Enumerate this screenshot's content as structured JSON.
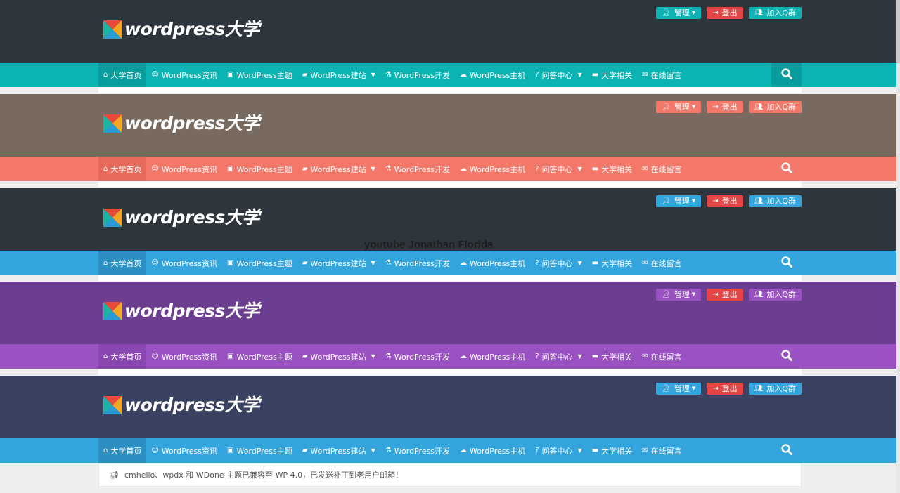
{
  "logo_text": "wordpress大学",
  "top_buttons": {
    "manage": {
      "icon": "user-icon",
      "label": "管理"
    },
    "logout": {
      "icon": "sign-out-icon",
      "label": "登出"
    },
    "join_qq": {
      "icon": "users-icon",
      "label": "加入Q群"
    }
  },
  "nav": [
    {
      "icon": "home-icon",
      "glyph": "⌂",
      "label": "大学首页",
      "dropdown": false
    },
    {
      "icon": "smile-icon",
      "glyph": "☺",
      "label": "WordPress资讯",
      "dropdown": false
    },
    {
      "icon": "picture-icon",
      "glyph": "▣",
      "label": "WordPress主题",
      "dropdown": false
    },
    {
      "icon": "book-icon",
      "glyph": "▰",
      "label": "WordPress建站",
      "dropdown": true
    },
    {
      "icon": "flask-icon",
      "glyph": "⚗",
      "label": "WordPress开发",
      "dropdown": false
    },
    {
      "icon": "cloud-icon",
      "glyph": "☁",
      "label": "WordPress主机",
      "dropdown": false
    },
    {
      "icon": "question-icon",
      "glyph": "?",
      "label": "问答中心",
      "dropdown": true
    },
    {
      "icon": "laptop-icon",
      "glyph": "▬",
      "label": "大学相关",
      "dropdown": false
    },
    {
      "icon": "comments-icon",
      "glyph": "✉",
      "label": "在线留言",
      "dropdown": false
    }
  ],
  "variants": [
    {
      "name": "teal",
      "header_bg": "#2f353d",
      "nav_bg": "#0cb3b3",
      "active_bg": "#0a9d9d",
      "search_bg": "#0a9d9d",
      "manage_bg": "#0cb3b3",
      "logout_bg": "#e54444",
      "join_bg": "#0cb3b3"
    },
    {
      "name": "coral",
      "header_bg": "#786a5e",
      "nav_bg": "#f3786a",
      "active_bg": "#e66a5b",
      "search_bg": "#f3786a",
      "manage_bg": "#f3786a",
      "logout_bg": "#f3786a",
      "join_bg": "#f3786a"
    },
    {
      "name": "blue",
      "header_bg": "#2f353d",
      "nav_bg": "#34a4dc",
      "active_bg": "#2c8ec1",
      "search_bg": "#34a4dc",
      "manage_bg": "#34a4dc",
      "logout_bg": "#e54444",
      "join_bg": "#34a4dc"
    },
    {
      "name": "purple",
      "header_bg": "#6c3e8f",
      "nav_bg": "#9a52c2",
      "active_bg": "#8a46b1",
      "search_bg": "#9a52c2",
      "manage_bg": "#9a52c2",
      "logout_bg": "#e54444",
      "join_bg": "#9a52c2"
    },
    {
      "name": "navy",
      "header_bg": "#3a4262",
      "nav_bg": "#34a4dc",
      "active_bg": "#2c8ec1",
      "search_bg": "#34a4dc",
      "manage_bg": "#34a4dc",
      "logout_bg": "#e54444",
      "join_bg": "#34a4dc"
    }
  ],
  "watermark": "youtube Jonathan Florida",
  "notice": {
    "icon": "bullhorn-icon",
    "text": "cmhello、wpdx 和 WDone 主题已兼容至 WP 4.0，已发送补丁到老用户邮箱！"
  }
}
